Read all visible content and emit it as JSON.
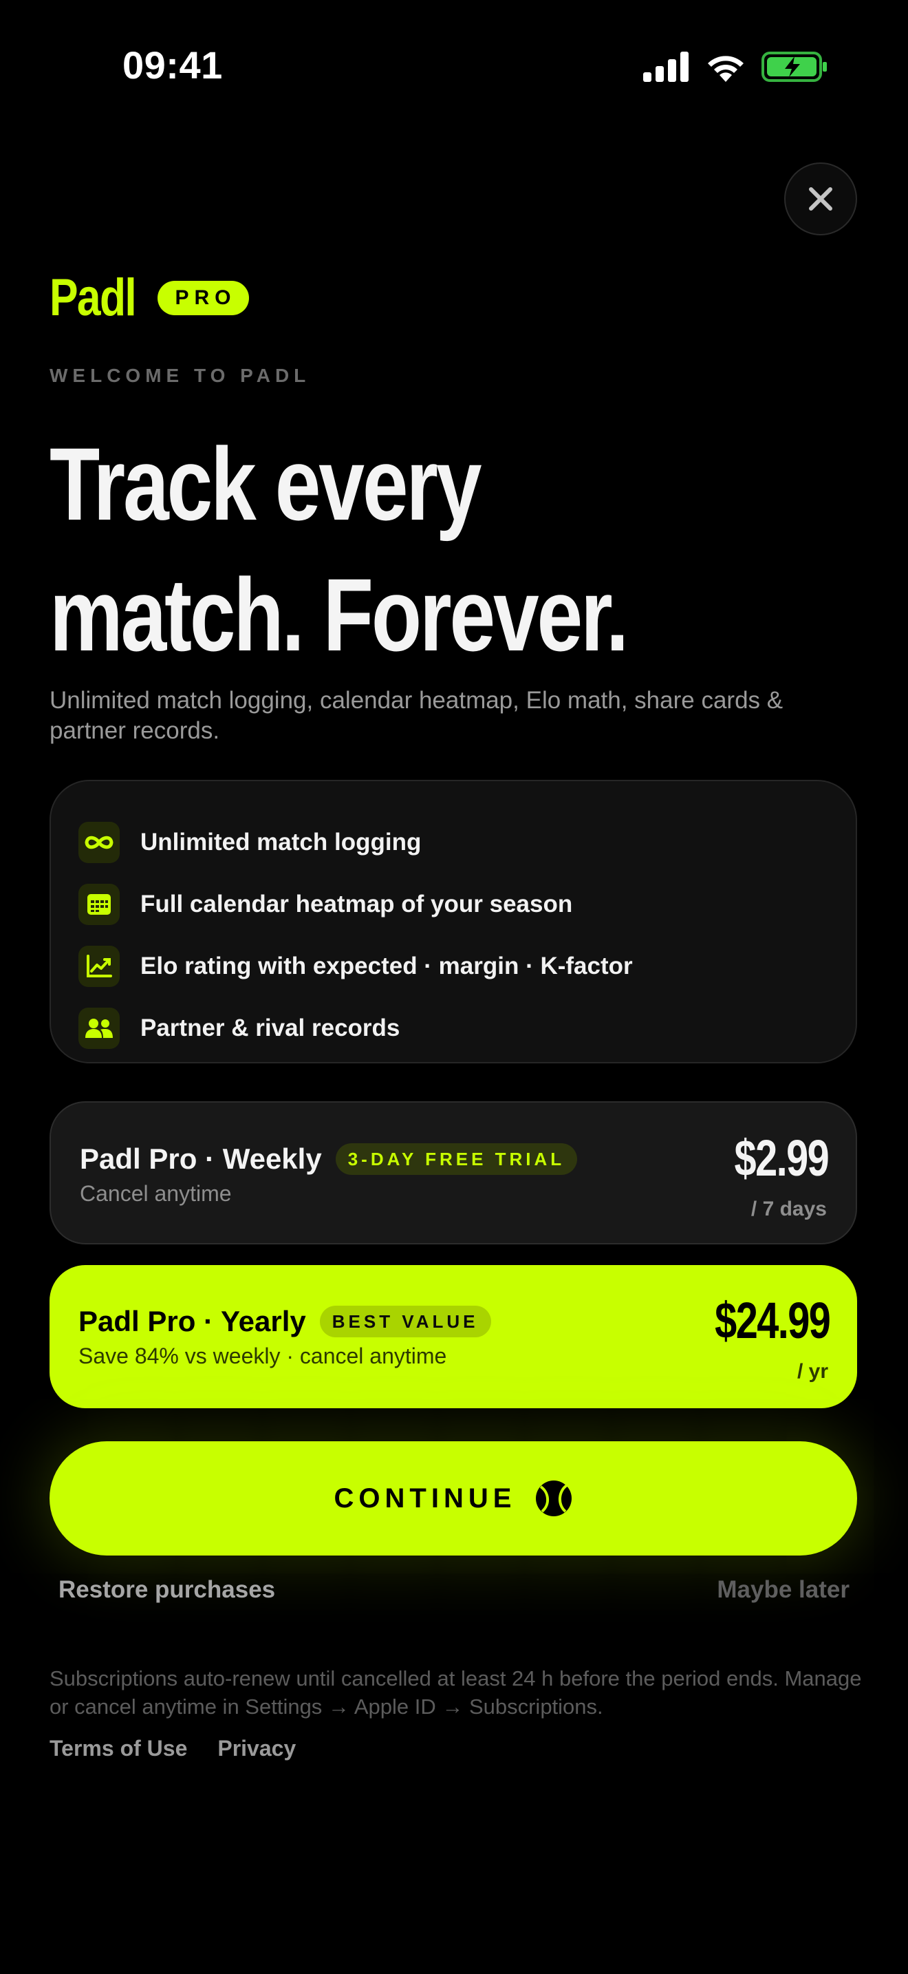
{
  "status_bar": {
    "time": "09:41",
    "icons": [
      "cellular-signal-icon",
      "wifi-icon",
      "battery-charging-icon"
    ],
    "battery_color": "#3fd14b"
  },
  "brand": {
    "logo": "Padl",
    "badge": "PRO",
    "accent_color": "#c8ff00"
  },
  "eyebrow": "WELCOME TO PADL",
  "headline": {
    "line1": "Track every",
    "line2": "match. Forever."
  },
  "subtitle": "Unlimited match logging, calendar heatmap, Elo math, share cards & partner records.",
  "features": [
    {
      "icon": "infinity-icon",
      "label": "Unlimited match logging"
    },
    {
      "icon": "calendar-icon",
      "label": "Full calendar heatmap of your season"
    },
    {
      "icon": "chart-icon",
      "label": "Elo rating with expected · margin · K-factor"
    },
    {
      "icon": "people-icon",
      "label": "Partner & rival records"
    }
  ],
  "plans": {
    "weekly": {
      "name": "Padl Pro · Weekly",
      "badge": "3-DAY FREE TRIAL",
      "subtitle": "Cancel anytime",
      "price": "$2.99",
      "period": "/ 7 days",
      "selected": false
    },
    "yearly": {
      "name": "Padl Pro · Yearly",
      "badge": "BEST VALUE",
      "subtitle": "Save 84% vs weekly · cancel anytime",
      "price": "$24.99",
      "period": "/ yr",
      "selected": true
    }
  },
  "cta": {
    "label": "CONTINUE",
    "icon": "tennis-ball-icon"
  },
  "restore_label": "Restore purchases",
  "later_label": "Maybe later",
  "legal": "Subscriptions auto-renew until cancelled at least 24 h before the period ends. Manage or cancel anytime in Settings → Apple ID → Subscriptions.",
  "links": {
    "terms": "Terms of Use",
    "privacy": "Privacy"
  }
}
